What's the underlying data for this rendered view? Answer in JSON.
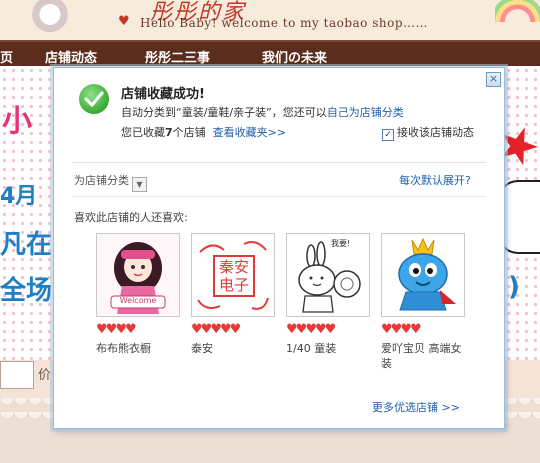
{
  "background_page": {
    "header": {
      "title_deco": "彤彤的家",
      "slogan": "Hello Baby! welcome to my taobao shop……"
    },
    "nav": [
      "页",
      "店铺动态",
      "彤彤二三事",
      "我们の未来"
    ],
    "banner_text": {
      "line1": "小",
      "line2": "4月",
      "line3": "凡在",
      "line4": "全场"
    },
    "search_price_label": "价",
    "side_glyph": ")"
  },
  "dialog": {
    "close_label": "×",
    "title": "店铺收藏成功!",
    "line1_prefix": "自动分类到“童装/童鞋/亲子装”，您还可以",
    "line1_link": "自己为店铺分类",
    "line2_prefix": "您已收藏",
    "line2_count": "7",
    "line2_suffix": "个店铺",
    "view_favorites_link": "查看收藏夹>>",
    "subscribe_checkbox_label": "接收该店铺动态",
    "subscribe_checked": true,
    "category_select_label": "为店铺分类",
    "default_expand_link": "每次默认展开?",
    "recommend_title": "喜欢此店铺的人还喜欢:",
    "more_shops_link": "更多优选店铺 >>"
  },
  "shops": [
    {
      "name": "布布熊衣橱",
      "hearts": 4,
      "thumb": "doll-icon",
      "thumb_text": "Welcome"
    },
    {
      "name": "泰安",
      "hearts": 5,
      "thumb": "seal-icon",
      "thumb_text": "秦安电子"
    },
    {
      "name": "1/40 童装",
      "hearts": 5,
      "thumb": "bunny-icon",
      "thumb_text": "我要!"
    },
    {
      "name": "爱吖宝贝 高端女装",
      "hearts": 4,
      "thumb": "blue-mascot-icon",
      "thumb_text": ""
    }
  ],
  "colors": {
    "link": "#1f5fa8",
    "heart": "#e63a3a",
    "nav_bg": "#5a2d1c",
    "dialog_border": "#9dbad6"
  }
}
